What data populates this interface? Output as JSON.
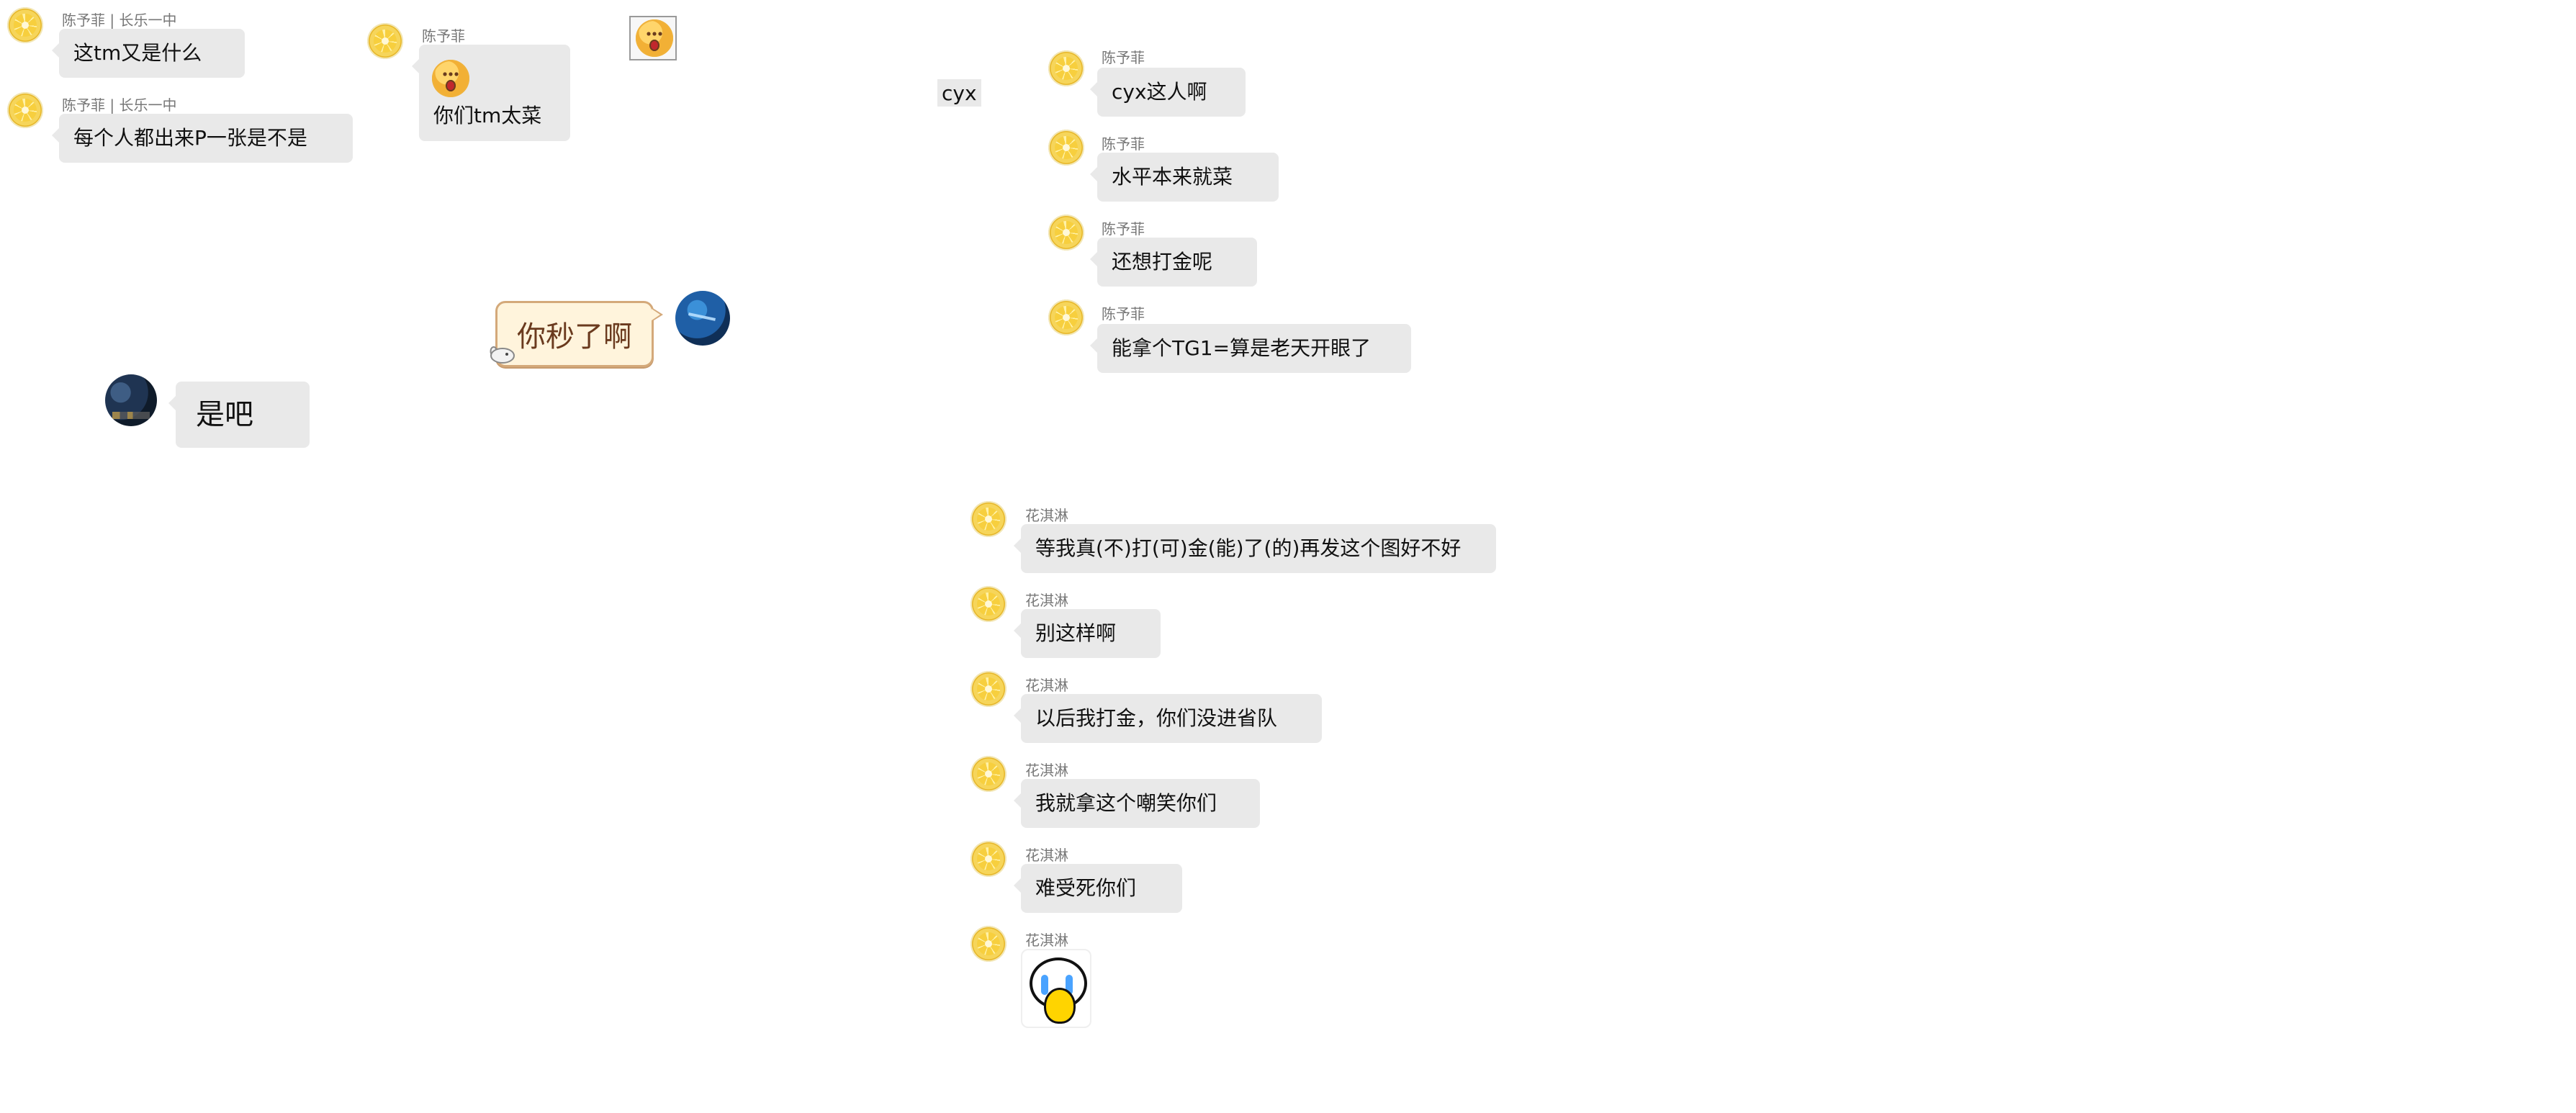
{
  "messages": {
    "m1": {
      "sender": "陈予菲 | 长乐一中",
      "text": "这tm又是什么"
    },
    "m2": {
      "sender": "陈予菲 | 长乐一中",
      "text": "每个人都出来P一张是不是"
    },
    "m3": {
      "sender": "陈予菲",
      "text": "你们tm太菜"
    },
    "m4": {
      "text": "你秒了啊"
    },
    "m5": {
      "text": "是吧"
    },
    "m6": {
      "sender": "陈予菲",
      "text": "cyx这人啊"
    },
    "m7": {
      "sender": "陈予菲",
      "text": "水平本来就菜"
    },
    "m8": {
      "sender": "陈予菲",
      "text": "还想打金呢"
    },
    "m9": {
      "sender": "陈予菲",
      "text": "能拿个TG1=算是老天开眼了"
    },
    "m10": {
      "sender": "花淇淋",
      "text": "等我真(不)打(可)金(能)了(的)再发这个图好不好"
    },
    "m11": {
      "sender": "花淇淋",
      "text": "别这样啊"
    },
    "m12": {
      "sender": "花淇淋",
      "text": "以后我打金，你们没进省队"
    },
    "m13": {
      "sender": "花淇淋",
      "text": "我就拿这个嘲笑你们"
    },
    "m14": {
      "sender": "花淇淋",
      "text": "难受死你们"
    },
    "m15": {
      "sender": "花淇淋"
    }
  },
  "misc": {
    "cyx_tag": "cyx"
  },
  "icons": {
    "lemon_avatar": "lemon-avatar",
    "night_avatar": "night-sky-avatar",
    "blue_avatar": "blue-comet-avatar",
    "surprised_emoji": "surprised-face-emoji",
    "sticker_box": "surprised-sticker",
    "cry_sticker": "crying-lemon-sticker",
    "rabbit": "rabbit-icon"
  }
}
